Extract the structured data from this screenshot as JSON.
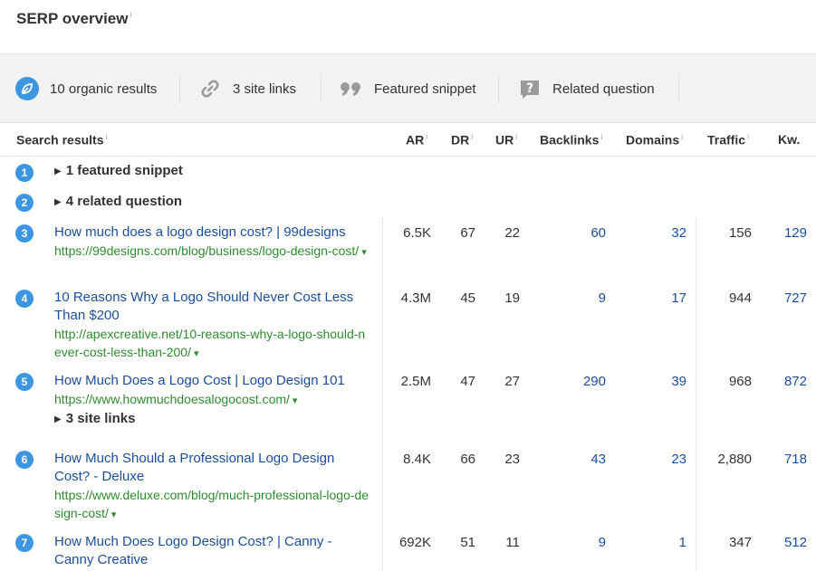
{
  "header": {
    "title": "SERP overview",
    "info": "i"
  },
  "features": [
    {
      "icon": "leaf-icon",
      "label": "10 organic results"
    },
    {
      "icon": "chain-link-icon",
      "label": "3 site links"
    },
    {
      "icon": "quote-icon",
      "label": "Featured snippet"
    },
    {
      "icon": "question-icon",
      "label": "Related question"
    }
  ],
  "columns": [
    {
      "label": "Search results",
      "info": "i"
    },
    {
      "label": "AR",
      "info": "i"
    },
    {
      "label": "DR",
      "info": "i"
    },
    {
      "label": "UR",
      "info": "i"
    },
    {
      "label": "Backlinks",
      "info": "i"
    },
    {
      "label": "Domains",
      "info": "i"
    },
    {
      "label": "Traffic",
      "info": "i"
    },
    {
      "label": "Kw.",
      "info": ""
    }
  ],
  "groups": [
    {
      "num": "1",
      "label": "1 featured snippet"
    },
    {
      "num": "2",
      "label": "4 related question"
    }
  ],
  "results": [
    {
      "num": "3",
      "title": "How much does a logo design cost? | 99designs",
      "url": "https://99designs.com/blog/business/logo-design-cost/",
      "ar": "6.5K",
      "dr": "67",
      "ur": "22",
      "backlinks": "60",
      "domains": "32",
      "traffic": "156",
      "kw": "129"
    },
    {
      "num": "4",
      "title": "10 Reasons Why a Logo Should Never Cost Less Than $200",
      "url": "http://apexcreative.net/10-reasons-why-a-logo-should-never-cost-less-than-200/",
      "ar": "4.3M",
      "dr": "45",
      "ur": "19",
      "backlinks": "9",
      "domains": "17",
      "traffic": "944",
      "kw": "727"
    },
    {
      "num": "5",
      "title": "How Much Does a Logo Cost | Logo Design 101",
      "url": "https://www.howmuchdoesalogocost.com/",
      "sitelinks": "3 site links",
      "ar": "2.5M",
      "dr": "47",
      "ur": "27",
      "backlinks": "290",
      "domains": "39",
      "traffic": "968",
      "kw": "872"
    },
    {
      "num": "6",
      "title": "How Much Should a Professional Logo Design Cost? - Deluxe",
      "url": "https://www.deluxe.com/blog/much-professional-logo-design-cost/",
      "ar": "8.4K",
      "dr": "66",
      "ur": "23",
      "backlinks": "43",
      "domains": "23",
      "traffic": "2,880",
      "kw": "718"
    },
    {
      "num": "7",
      "title": "How Much Does Logo Design Cost? | Canny - Canny Creative",
      "url": "",
      "ar": "692K",
      "dr": "51",
      "ur": "11",
      "backlinks": "9",
      "domains": "1",
      "traffic": "347",
      "kw": "512"
    }
  ],
  "caret": "▾",
  "colors": {
    "badge": "#3c96e0",
    "link": "#1a4e9c",
    "url": "#2f8c2f",
    "panel": "#f2f2f2"
  }
}
